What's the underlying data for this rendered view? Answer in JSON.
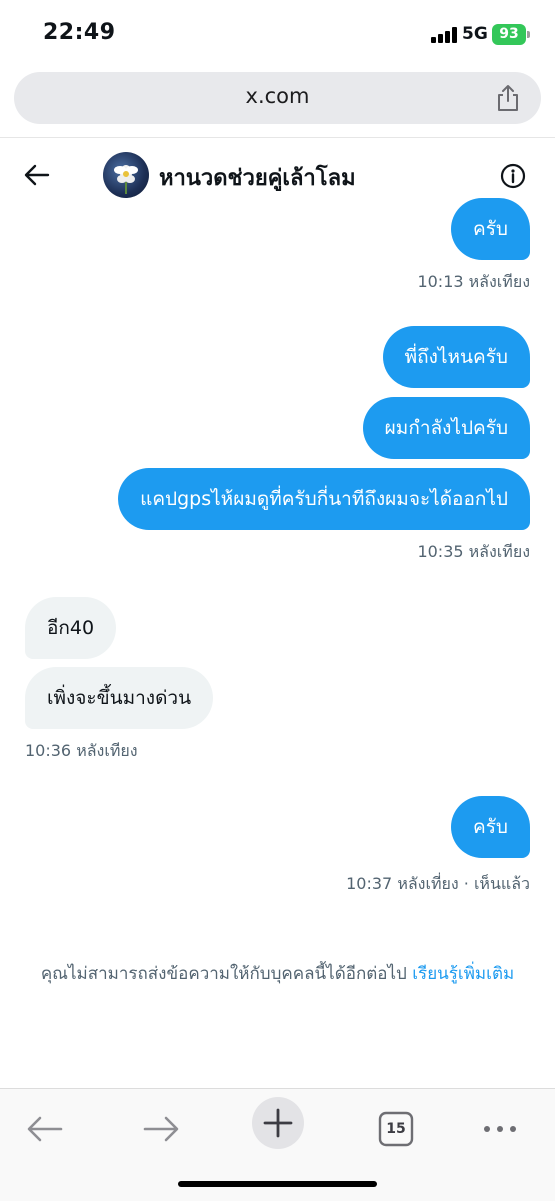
{
  "status_bar": {
    "time": "22:49",
    "network": "5G",
    "battery": "93"
  },
  "browser": {
    "url": "x.com",
    "tab_count": "15"
  },
  "chat": {
    "title": "หานวดช่วยคู่เล้าโลม",
    "messages": [
      {
        "direction": "out",
        "text": "ครับ"
      },
      {
        "direction": "timestamp-out",
        "text": "10:13 หลังเทียง"
      },
      {
        "direction": "out",
        "text": "พี่ถึงไหนครับ"
      },
      {
        "direction": "out",
        "text": "ผมกำลังไปครับ"
      },
      {
        "direction": "out",
        "text": "แคปgpsไห้ผมดูที่ครับกี่นาทีถึงผมจะได้ออกไป"
      },
      {
        "direction": "timestamp-out",
        "text": "10:35 หลังเทียง"
      },
      {
        "direction": "in",
        "text": "อีก40"
      },
      {
        "direction": "in",
        "text": "เพิ่งจะขึ้นมางด่วน"
      },
      {
        "direction": "timestamp-in",
        "text": "10:36 หลังเทียง"
      },
      {
        "direction": "out",
        "text": "ครับ"
      },
      {
        "direction": "timestamp-out",
        "text": "10:37 หลังเที่ยง · เห็นแล้ว"
      }
    ],
    "notice": "คุณไม่สามารถส่งข้อความให้กับบุคคลนี้ได้อีกต่อไป",
    "notice_link": "เรียนรู้เพิ่มเติม"
  },
  "colors": {
    "accent": "#1d9bf0",
    "incoming_bubble": "#eff3f4",
    "muted_text": "#536471",
    "battery": "#33c759"
  }
}
